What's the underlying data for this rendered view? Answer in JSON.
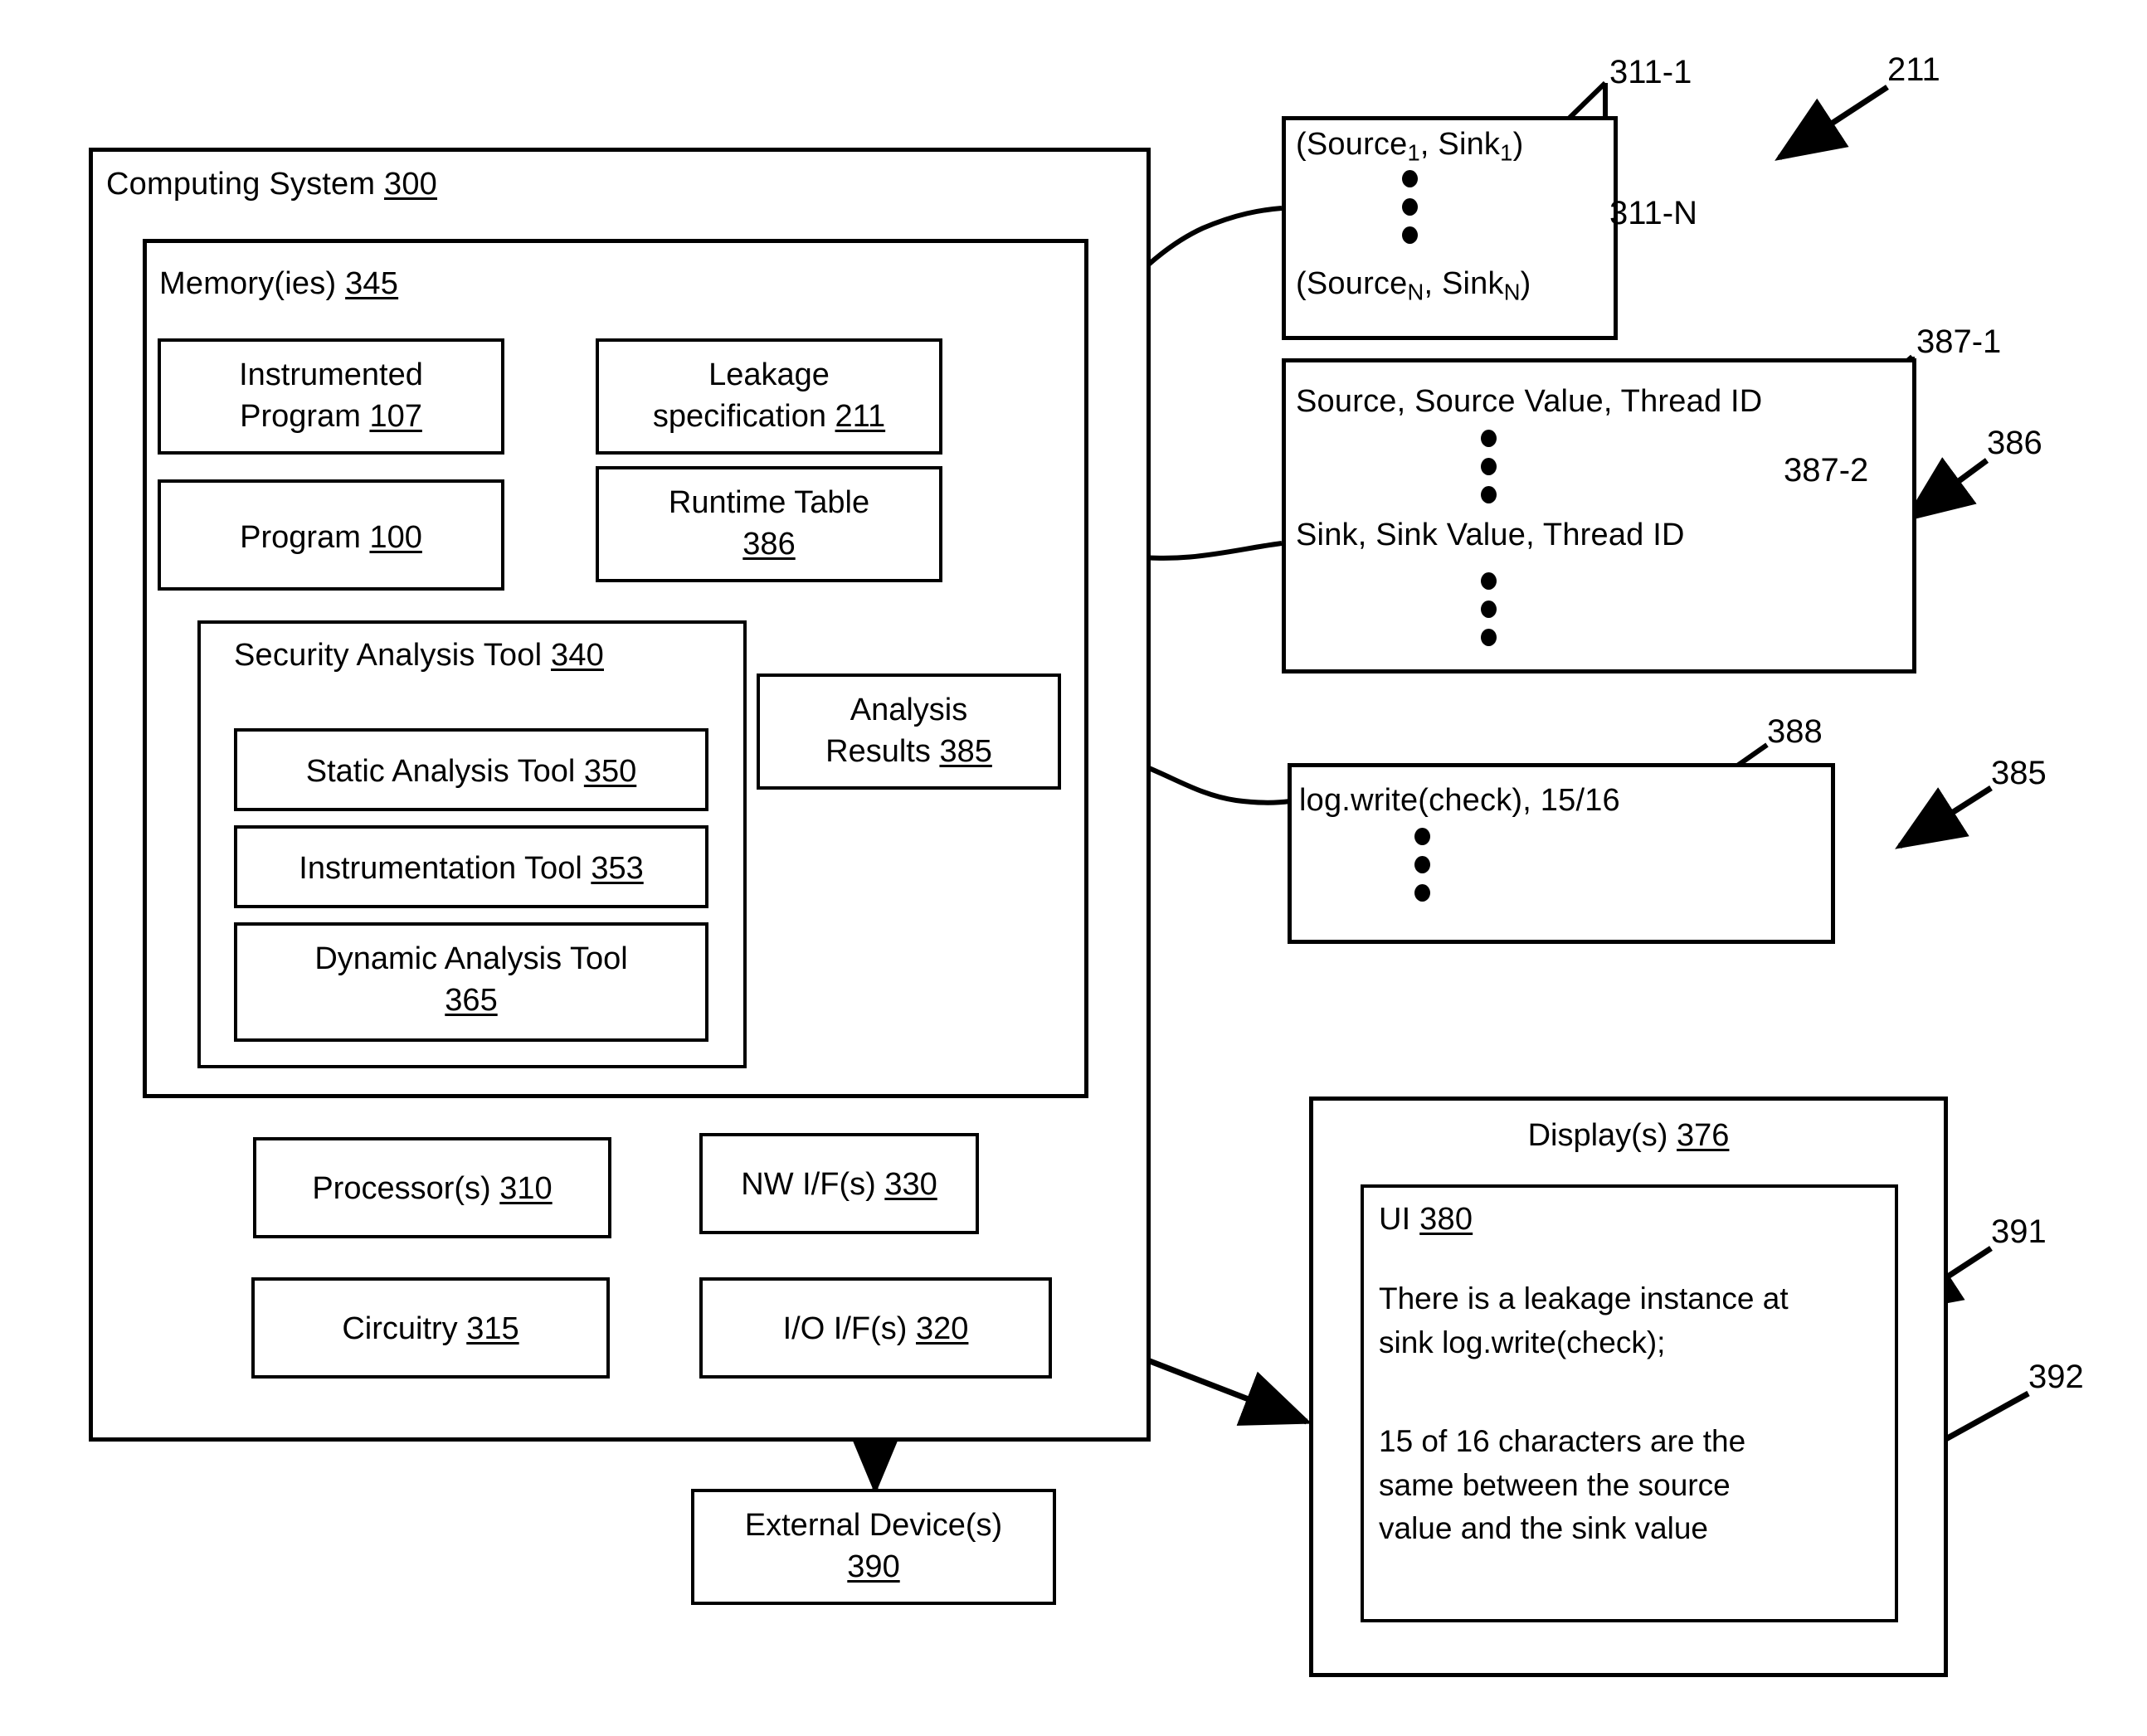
{
  "figure": {
    "system": {
      "title_text": "Computing System",
      "title_ref": "300",
      "memory": {
        "title_text": "Memory(ies)",
        "title_ref": "345",
        "boxes": {
          "instrumented_program": {
            "line1": "Instrumented",
            "line2": "Program",
            "ref": "107"
          },
          "program": {
            "line1": "Program",
            "ref": "100"
          },
          "leakage_specification": {
            "line1": "Leakage",
            "line2": "specification",
            "ref": "211"
          },
          "runtime_table": {
            "line1": "Runtime Table",
            "ref": "386"
          }
        },
        "security_analysis_tool": {
          "title_text": "Security Analysis Tool",
          "title_ref": "340",
          "tools": [
            {
              "label": "Static Analysis Tool",
              "ref": "350"
            },
            {
              "label": "Instrumentation Tool",
              "ref": "353"
            },
            {
              "label": "Dynamic Analysis Tool",
              "ref": "365"
            }
          ]
        }
      },
      "analysis_results": {
        "line1": "Analysis",
        "line2": "Results",
        "ref": "385"
      },
      "hardware": [
        {
          "label": "Processor(s)",
          "ref": "310"
        },
        {
          "label": "NW I/F(s)",
          "ref": "330"
        },
        {
          "label": "Circuitry",
          "ref": "315"
        },
        {
          "label": "I/O I/F(s)",
          "ref": "320"
        }
      ],
      "external_device": {
        "line1": "External Device(s)",
        "ref": "390"
      }
    },
    "leakage_spec_detail": {
      "entry_first": "(Source<sub>1</sub>, Sink<sub>1</sub>)",
      "entry_first_plain": "(Source1, Sink1)",
      "entry_last": "(Source<sub>N</sub>, Sink<sub>N</sub>)",
      "entry_last_plain": "(SourceN, SinkN)",
      "ref_first": "311-1",
      "ref_last": "311-N",
      "ref_block": "211"
    },
    "runtime_table_detail": {
      "row_source": "Source, Source Value, Thread ID",
      "row_sink": "Sink, Sink Value, Thread ID",
      "ref_source": "387-1",
      "ref_sink": "387-2",
      "ref_block": "386"
    },
    "analysis_results_detail": {
      "row": "log.write(check), 15/16",
      "ref_row": "388",
      "ref_block": "385"
    },
    "display": {
      "title_text": "Display(s)",
      "title_ref": "376",
      "ui": {
        "title_text": "UI",
        "title_ref": "380",
        "message_1": "There is a leakage instance at\nsink log.write(check);",
        "message_2": "15 of 16 characters are the\nsame between the source\nvalue and the sink value",
        "ref_message_1": "391",
        "ref_message_2": "392"
      }
    }
  }
}
